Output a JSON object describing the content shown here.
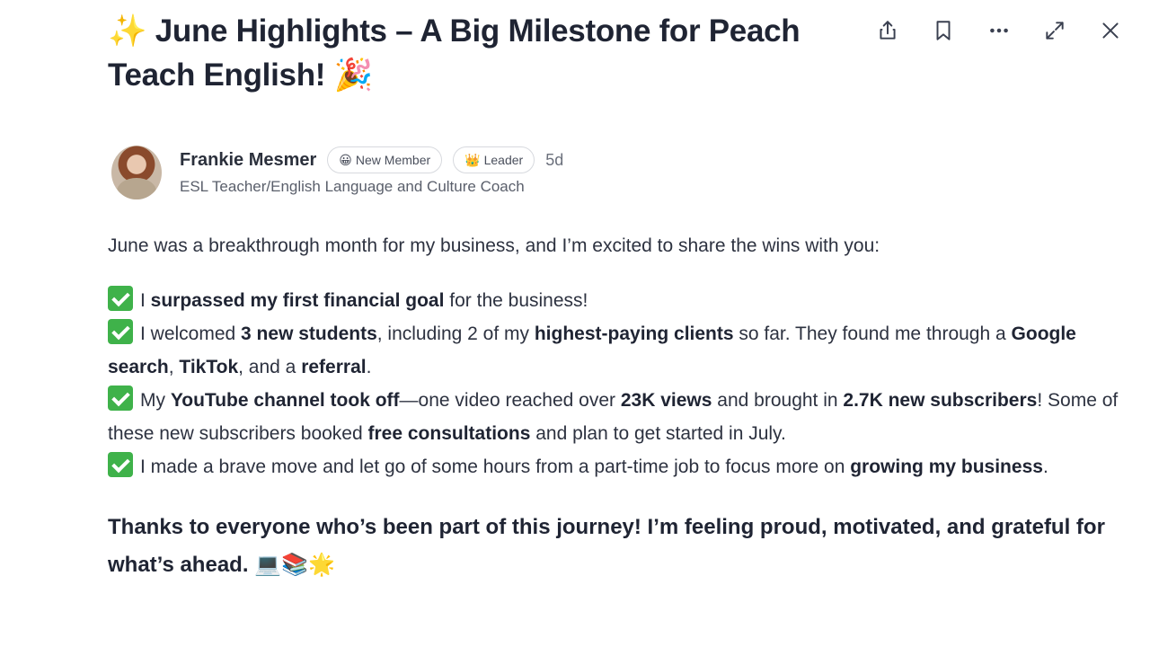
{
  "post": {
    "title_emoji": "✨",
    "title": "June Highlights – A Big Milestone for Peach Teach English!",
    "title_end_emoji": "🎉"
  },
  "toolbar": {
    "share_icon": "share-icon",
    "bookmark_icon": "bookmark-icon",
    "more_icon": "more-icon",
    "expand_icon": "expand-icon",
    "close_icon": "close-icon"
  },
  "author": {
    "name": "Frankie Mesmer",
    "badge_new_member_emoji": "😀",
    "badge_new_member": "New Member",
    "badge_leader_emoji": "👑",
    "badge_leader": "Leader",
    "time": "5d",
    "title": "ESL Teacher/English Language and Culture Coach"
  },
  "body": {
    "intro": "June was a breakthrough month for my business, and I’m excited to share the wins with you:",
    "item1": {
      "pre": "I ",
      "b1": "surpassed my first financial goal",
      "post": " for the business!"
    },
    "item2": {
      "pre": "I welcomed ",
      "b1": "3 new students",
      "mid1": ", including 2 of my ",
      "b2": "highest-paying clients",
      "mid2": " so far. They found me through a ",
      "b3": "Google search",
      "mid3": ", ",
      "b4": "TikTok",
      "mid4": ", and a ",
      "b5": "referral",
      "post": "."
    },
    "item3": {
      "pre": "My ",
      "b1": "YouTube channel took off",
      "mid1": "—one video reached over ",
      "b2": "23K views",
      "mid2": " and brought in ",
      "b3": "2.7K new subscribers",
      "mid3": "! Some of these new subscribers booked ",
      "b4": "free consultations",
      "post": " and plan to get started in July."
    },
    "item4": {
      "pre": "I made a brave move and let go of some hours from a part-time job to focus more  on ",
      "b1": "growing my business",
      "post": "."
    },
    "closing": "Thanks to everyone who’s been part of this journey! I’m feeling proud, motivated, and grateful for what’s ahead.",
    "closing_emojis": "💻📚🌟"
  }
}
